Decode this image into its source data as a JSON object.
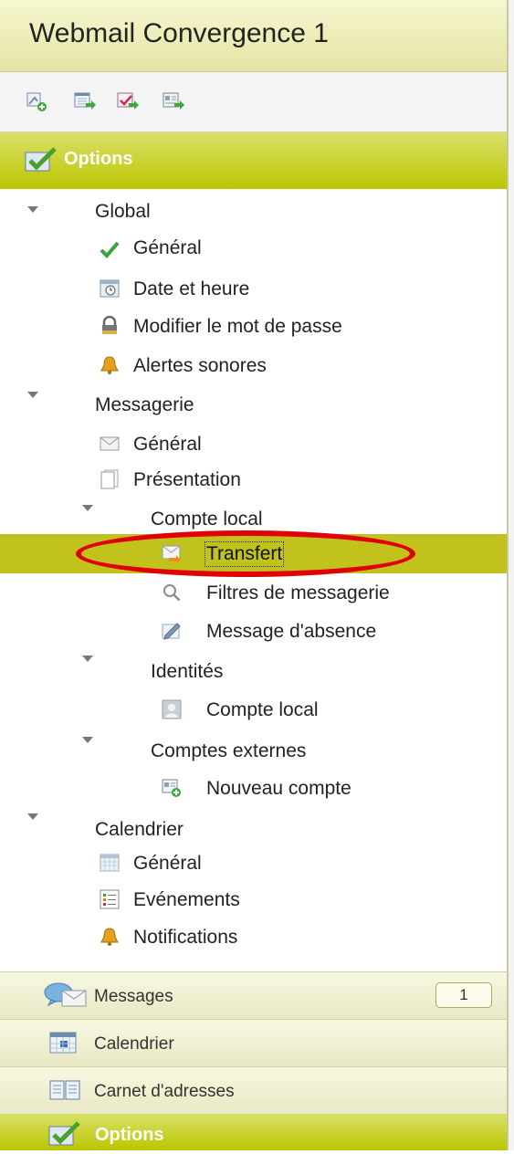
{
  "app": {
    "title": "Webmail Convergence 1"
  },
  "colors": {
    "accent": "#bcc600",
    "selected": "#c2c21c",
    "highlight_ellipse": "#e00000"
  },
  "toolbar": {
    "buttons": [
      {
        "icon": "new-contact-icon"
      },
      {
        "icon": "new-calendar-icon"
      },
      {
        "icon": "new-task-icon"
      },
      {
        "icon": "new-address-card-icon"
      }
    ]
  },
  "section": {
    "label": "Options",
    "icon": "check-options-icon"
  },
  "tree": {
    "global": {
      "label": "Global",
      "general": "Général",
      "date_time": "Date et heure",
      "change_password": "Modifier le mot de passe",
      "sound_alerts": "Alertes sonores"
    },
    "mail": {
      "label": "Messagerie",
      "general": "Général",
      "presentation": "Présentation",
      "local_account": {
        "label": "Compte local",
        "forward": "Transfert",
        "filters": "Filtres de messagerie",
        "absence": "Message d'absence"
      },
      "identities": {
        "label": "Identités",
        "local_account": "Compte local"
      },
      "external_accounts": {
        "label": "Comptes externes",
        "new_account": "Nouveau compte"
      }
    },
    "calendar": {
      "label": "Calendrier",
      "general": "Général",
      "events": "Evénements",
      "notifications": "Notifications"
    }
  },
  "footer": {
    "messages": {
      "label": "Messages",
      "badge": "1"
    },
    "calendar": {
      "label": "Calendrier"
    },
    "address_book": {
      "label": "Carnet d'adresses"
    },
    "options": {
      "label": "Options"
    }
  }
}
